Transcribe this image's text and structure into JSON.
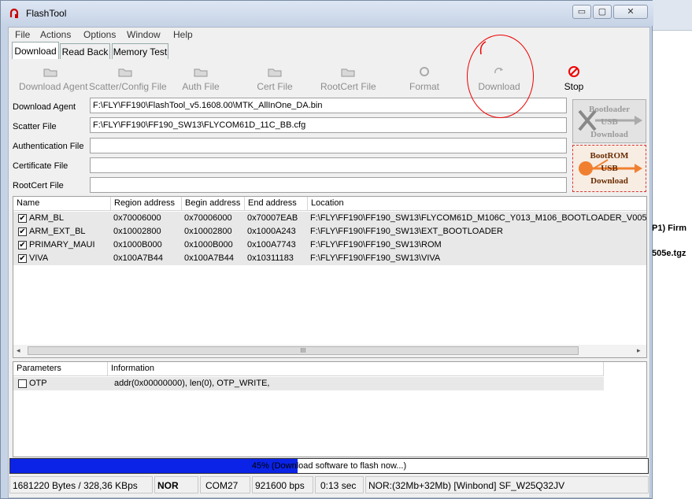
{
  "background": {
    "text1": "P1) Firm",
    "text2": "505e.tgz"
  },
  "window": {
    "title": "FlashTool"
  },
  "title_buttons": {
    "minimize": "▭",
    "maximize": "▢",
    "close": "✕"
  },
  "menu": [
    "File",
    "Actions",
    "Options",
    "Window",
    "Help"
  ],
  "tabs": [
    "Download",
    "Read Back",
    "Memory Test"
  ],
  "toolbar": {
    "download_agent": "Download Agent",
    "scatter_config": "Scatter/Config File",
    "auth_file": "Auth File",
    "cert_file": "Cert File",
    "rootcert_file": "RootCert File",
    "format": "Format",
    "download": "Download",
    "stop": "Stop"
  },
  "fields": {
    "download_agent": {
      "label": "Download Agent",
      "value": "F:\\FLY\\FF190\\FlashTool_v5.1608.00\\MTK_AllInOne_DA.bin"
    },
    "scatter_file": {
      "label": "Scatter File",
      "value": "F:\\FLY\\FF190\\FF190_SW13\\FLYCOM61D_11C_BB.cfg"
    },
    "authentication_file": {
      "label": "Authentication File",
      "value": ""
    },
    "certificate_file": {
      "label": "Certificate File",
      "value": ""
    },
    "rootcert_file": {
      "label": "RootCert File",
      "value": ""
    }
  },
  "side_buttons": {
    "bootloader": {
      "line1": "Bootloader",
      "line2": "USB",
      "line3": "Download"
    },
    "bootrom": {
      "line1": "BootROM",
      "line2": "USB",
      "line3": "Download"
    }
  },
  "table": {
    "headers": [
      "Name",
      "Region address",
      "Begin address",
      "End address",
      "Location"
    ],
    "rows": [
      {
        "checked": true,
        "name": "ARM_BL",
        "region": "0x70006000",
        "begin": "0x70006000",
        "end": "0x70007EAB",
        "location": "F:\\FLY\\FF190\\FF190_SW13\\FLYCOM61D_M106C_Y013_M106_BOOTLOADER_V005_"
      },
      {
        "checked": true,
        "name": "ARM_EXT_BL",
        "region": "0x10002800",
        "begin": "0x10002800",
        "end": "0x1000A243",
        "location": "F:\\FLY\\FF190\\FF190_SW13\\EXT_BOOTLOADER"
      },
      {
        "checked": true,
        "name": "PRIMARY_MAUI",
        "region": "0x1000B000",
        "begin": "0x1000B000",
        "end": "0x100A7743",
        "location": "F:\\FLY\\FF190\\FF190_SW13\\ROM"
      },
      {
        "checked": true,
        "name": "VIVA",
        "region": "0x100A7B44",
        "begin": "0x100A7B44",
        "end": "0x10311183",
        "location": "F:\\FLY\\FF190\\FF190_SW13\\VIVA"
      }
    ],
    "scroll_grip": "III"
  },
  "params": {
    "headers": [
      "Parameters",
      "Information"
    ],
    "rows": [
      {
        "checked": false,
        "name": "OTP",
        "info": "addr(0x00000000), len(0), OTP_WRITE,"
      }
    ]
  },
  "progress": {
    "percent": 45,
    "label": "45% (Download software to flash now...)"
  },
  "status": {
    "bytes": "1681220 Bytes / 328,36 KBps",
    "type": "NOR",
    "port": "COM27",
    "baud": "921600 bps",
    "time": "0:13 sec",
    "flash": "NOR:(32Mb+32Mb) [Winbond] SF_W25Q32JV"
  },
  "colors": {
    "progress": "#0a23e6",
    "annotation": "#e00000",
    "bootrom": "#f08030"
  }
}
